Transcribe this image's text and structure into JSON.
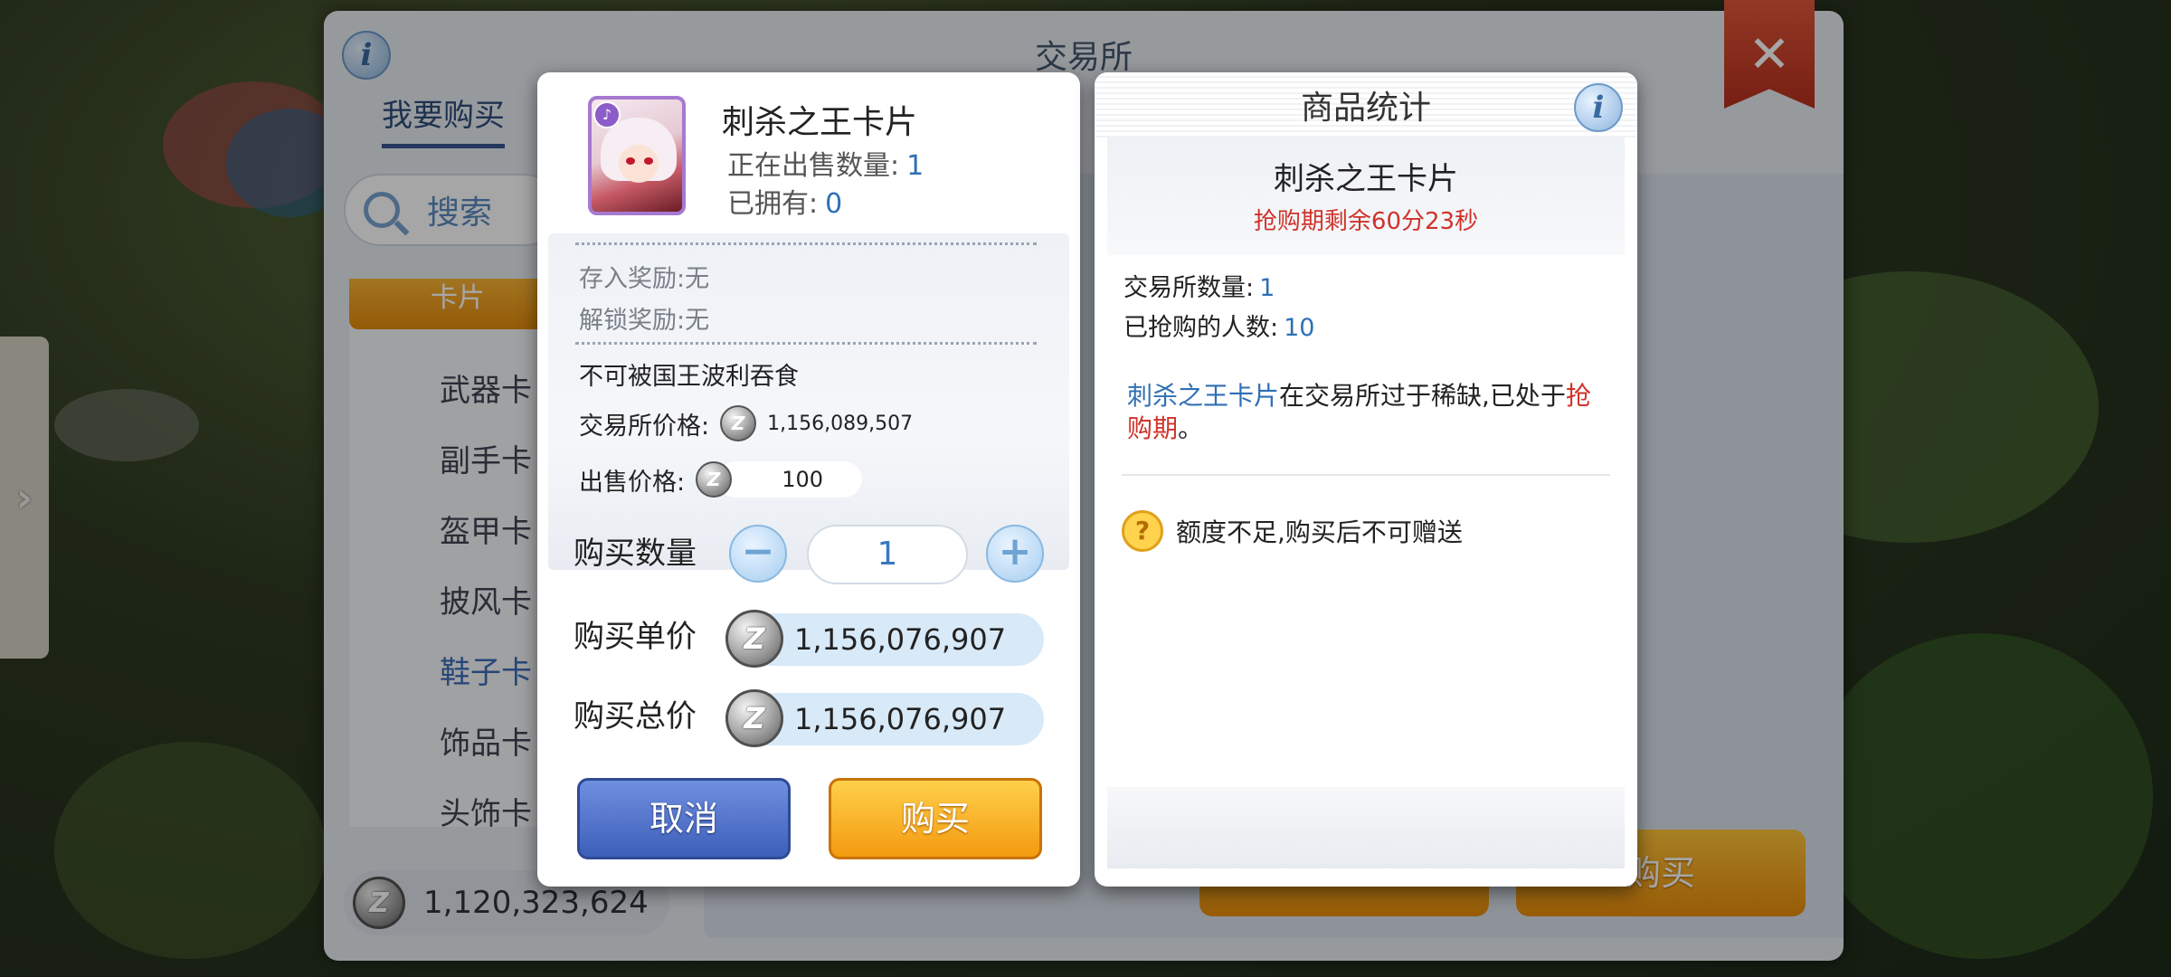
{
  "background": {
    "drawer_toggle": "›",
    "exchange": {
      "title": "交易所",
      "info_icon": "i",
      "tab_buy": "我要购买",
      "search_placeholder": "搜索",
      "category_header": "卡片",
      "categories": [
        "武器卡",
        "副手卡",
        "盔甲卡",
        "披风卡",
        "鞋子卡",
        "饰品卡",
        "头饰卡"
      ],
      "active_category": "鞋子卡",
      "balance": "1,120,323,624",
      "buy_button": "购买",
      "close_icon": "✕"
    }
  },
  "dialog": {
    "card_name": "刺杀之王卡片",
    "on_sale_label": "正在出售数量:",
    "on_sale_value": "1",
    "owned_label": "已拥有:",
    "owned_value": "0",
    "deposit_reward": "存入奖励:无",
    "unlock_reward": "解锁奖励:无",
    "note": "不可被国王波利吞食",
    "exchange_price_label": "交易所价格:",
    "exchange_price_value": "1,156,089,507",
    "sell_price_label": "出售价格:",
    "sell_price_value": "100",
    "quantity_label": "购买数量",
    "quantity_value": "1",
    "minus_icon": "−",
    "plus_icon": "+",
    "unit_price_label": "购买单价",
    "unit_price_value": "1,156,076,907",
    "total_price_label": "购买总价",
    "total_price_value": "1,156,076,907",
    "cancel_label": "取消",
    "buy_label": "购买",
    "coin_symbol": "Z"
  },
  "stats": {
    "title": "商品统计",
    "info_icon": "i",
    "item_name": "刺杀之王卡片",
    "timer": "抢购期剩余60分23秒",
    "exchange_count_label": "交易所数量:",
    "exchange_count_value": "1",
    "buyers_label": "已抢购的人数:",
    "buyers_value": "10",
    "desc_item": "刺杀之王卡片",
    "desc_middle": "在交易所过于稀缺,已处于",
    "desc_status": "抢购期",
    "desc_end": "。",
    "warning_icon": "?",
    "warning_text": "额度不足,购买后不可赠送"
  },
  "colors": {
    "accent_blue": "#2f6fb5",
    "alert_red": "#d0322a",
    "buy_orange": "#f39a10",
    "cancel_blue": "#3e5fb9"
  }
}
